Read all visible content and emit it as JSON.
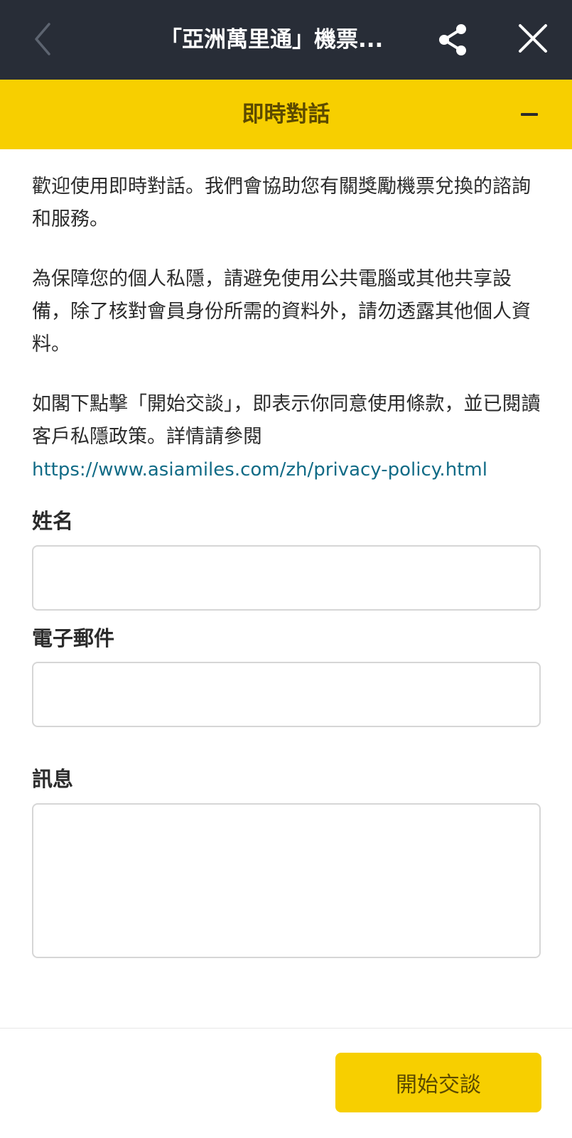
{
  "top_bar": {
    "title": "「亞洲萬里通」機票...",
    "icons": {
      "back": "chevron-left-icon",
      "share": "share-icon",
      "close": "close-icon"
    },
    "background": "#282d37"
  },
  "chat_panel": {
    "title": "即時對話",
    "accent": "#f7cf00",
    "minimize_icon": "minus-icon"
  },
  "intro": {
    "welcome": "歡迎使用即時對話。我們會協助您有關獎勵機票兌換的諮詢和服務。",
    "privacy_notice": "為保障您的個人私隱，請避免使用公共電腦或其他共享設備，除了核對會員身份所需的資料外，請勿透露其他個人資料。",
    "terms_text": "如閣下點擊「開始交談」，即表示你同意使用條款，並已閱讀客戶私隱政策。詳情請參閱",
    "privacy_link": "https://www.asiamiles.com/zh/privacy-policy.html"
  },
  "form": {
    "name": {
      "label": "姓名",
      "value": "",
      "placeholder": ""
    },
    "email": {
      "label": "電子郵件",
      "value": "",
      "placeholder": ""
    },
    "message": {
      "label": "訊息",
      "value": "",
      "placeholder": ""
    }
  },
  "footer": {
    "start_button": "開始交談"
  }
}
